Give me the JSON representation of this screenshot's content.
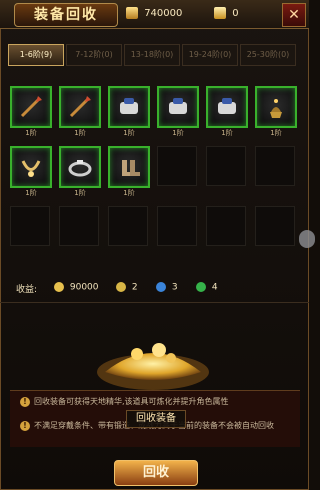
{
  "header": {
    "title": "装备回收",
    "gold_value": "740000",
    "gem_value": "0",
    "close_label": "✕"
  },
  "tabs": [
    {
      "label": "1-6阶(9)",
      "active": true
    },
    {
      "label": "7-12阶(0)",
      "active": false
    },
    {
      "label": "13-18阶(0)",
      "active": false
    },
    {
      "label": "19-24阶(0)",
      "active": false
    },
    {
      "label": "25-30阶(0)",
      "active": false
    }
  ],
  "inventory": {
    "rows": [
      [
        {
          "icon": "spear-icon",
          "level": "1阶"
        },
        {
          "icon": "spear-icon",
          "level": "1阶"
        },
        {
          "icon": "gauntlets-icon",
          "level": "1阶"
        },
        {
          "icon": "gauntlets-icon",
          "level": "1阶"
        },
        {
          "icon": "gauntlets-icon",
          "level": "1阶"
        },
        {
          "icon": "gauntlets-icon",
          "level": "1阶"
        },
        {
          "icon": "lamp-icon",
          "level": "1阶"
        }
      ],
      [
        {
          "icon": "necklace-icon",
          "level": "1阶"
        },
        {
          "icon": "ring-icon",
          "level": "1阶"
        },
        {
          "icon": "boots-icon",
          "level": "1阶"
        },
        {
          "icon": null,
          "level": ""
        },
        {
          "icon": null,
          "level": ""
        },
        {
          "icon": null,
          "level": ""
        },
        {
          "icon": null,
          "level": ""
        }
      ],
      [
        {
          "icon": null,
          "level": ""
        },
        {
          "icon": null,
          "level": ""
        },
        {
          "icon": null,
          "level": ""
        },
        {
          "icon": null,
          "level": ""
        },
        {
          "icon": null,
          "level": ""
        },
        {
          "icon": null,
          "level": ""
        },
        {
          "icon": null,
          "level": ""
        }
      ]
    ]
  },
  "earnings": {
    "label": "收益:",
    "values": [
      {
        "icon": "gold-coin-icon",
        "value": "90000",
        "color": "#e7c04d"
      },
      {
        "icon": "yellow-token-icon",
        "value": "2",
        "color": "#d8b646"
      },
      {
        "icon": "blue-token-icon",
        "value": "3",
        "color": "#3b84d9"
      },
      {
        "icon": "green-token-icon",
        "value": "4",
        "color": "#36b34a"
      }
    ]
  },
  "notice": {
    "line1": "回收装备可获得天地精华,该道具可炼化并提升角色属性",
    "line2": "不满足穿戴条件、带有锻造、或战力高于当前的装备不会被自动回收"
  },
  "tooltip": "回收装备",
  "button_label": "回收",
  "colors": {
    "accent": "#39b12c",
    "gold": "#e7c04d",
    "button": "#f2b24a"
  }
}
